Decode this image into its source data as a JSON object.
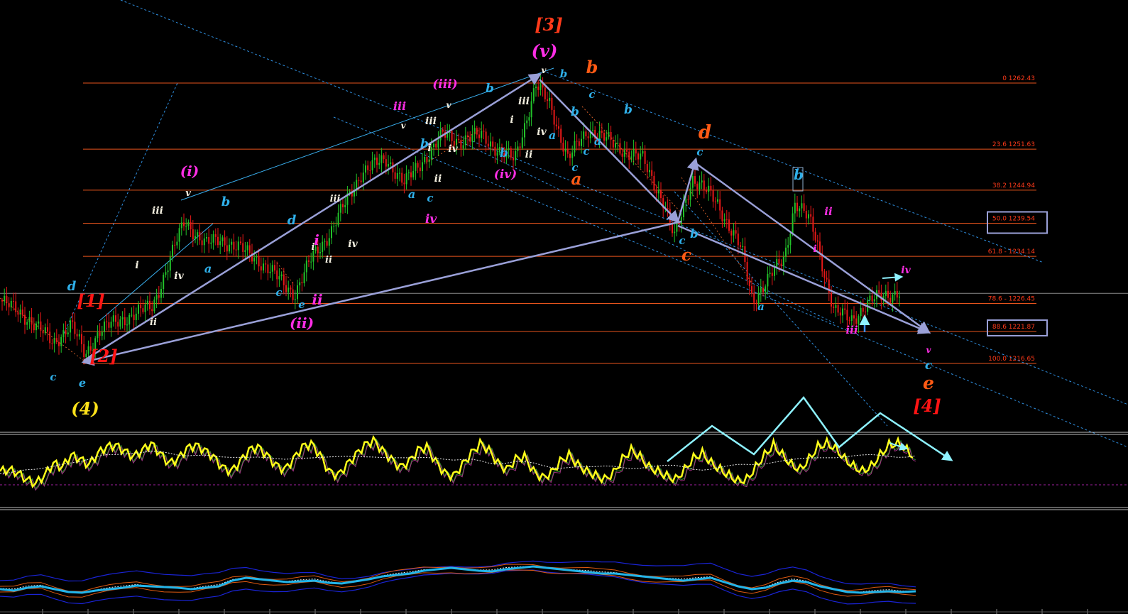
{
  "colors": {
    "background": "#000000",
    "fib_line": "#e8541c",
    "fib_text": "#ff3a1a",
    "trend_arrow": "#9aa0d8",
    "channel_blue": "#2f8fe0",
    "bull_candle": "#22c22a",
    "bear_candle": "#e81818",
    "oscillator": "#ffff1a",
    "signal_cyan": "#8ef2ff",
    "ma_cyan": "#22b5ea",
    "band_blue": "#1a24d6",
    "band_orange": "#e05a10"
  },
  "chart_data": [
    {
      "type": "candlestick",
      "title": "",
      "y_range": [
        1206.0,
        1268.5
      ],
      "fib_levels": [
        {
          "label": "0 1262.43",
          "value": 1262.43
        },
        {
          "label": "23.6 1251.63",
          "value": 1251.63
        },
        {
          "label": "38.2 1244.94",
          "value": 1244.94
        },
        {
          "label": "50.0 1239.54",
          "value": 1239.54,
          "boxed": true
        },
        {
          "label": "61.8 - 1234.14",
          "value": 1234.14
        },
        {
          "label": "78.6 - 1226.45",
          "value": 1226.45
        },
        {
          "label": "88.6 1221.87",
          "value": 1221.87,
          "boxed": true
        },
        {
          "label": "100.0 1216.65",
          "value": 1216.65
        }
      ],
      "current_price": 1228.1,
      "price_path": [
        [
          0,
          1227
        ],
        [
          40,
          1224
        ],
        [
          75,
          1220
        ],
        [
          100,
          1223
        ],
        [
          120,
          1218
        ],
        [
          140,
          1222
        ],
        [
          175,
          1224
        ],
        [
          215,
          1226
        ],
        [
          260,
          1240
        ],
        [
          290,
          1236
        ],
        [
          310,
          1237
        ],
        [
          360,
          1234
        ],
        [
          415,
          1228
        ],
        [
          440,
          1234
        ],
        [
          465,
          1238
        ],
        [
          510,
          1248
        ],
        [
          545,
          1250
        ],
        [
          570,
          1246
        ],
        [
          590,
          1249
        ],
        [
          625,
          1254
        ],
        [
          650,
          1253
        ],
        [
          680,
          1254
        ],
        [
          705,
          1251
        ],
        [
          725,
          1250
        ],
        [
          755,
          1262
        ],
        [
          775,
          1259
        ],
        [
          800,
          1250
        ],
        [
          830,
          1255
        ],
        [
          870,
          1252
        ],
        [
          905,
          1250
        ],
        [
          935,
          1243
        ],
        [
          950,
          1237
        ],
        [
          975,
          1247
        ],
        [
          1010,
          1243
        ],
        [
          1045,
          1235
        ],
        [
          1060,
          1227
        ],
        [
          1080,
          1230
        ],
        [
          1105,
          1234
        ],
        [
          1120,
          1243
        ],
        [
          1140,
          1240
        ],
        [
          1150,
          1237
        ],
        [
          1175,
          1225
        ],
        [
          1200,
          1224
        ],
        [
          1230,
          1227
        ],
        [
          1245,
          1228
        ],
        [
          1270,
          1228.1
        ]
      ],
      "annotations": [
        {
          "text": "[3]",
          "color": "#ff3a1a",
          "size": 24
        },
        {
          "text": "(v)",
          "color": "#ff2ee6",
          "size": 24
        },
        {
          "text": "b",
          "color": "#ff5a14",
          "size": 24
        },
        {
          "text": "v",
          "color": "#f4f0e0",
          "size": 12
        },
        {
          "text": "b",
          "color": "#2fb0ea",
          "size": 15
        },
        {
          "text": "(iii)",
          "color": "#ff2ee6",
          "size": 17
        },
        {
          "text": "b",
          "color": "#2fb0ea",
          "size": 17
        },
        {
          "text": "iii",
          "color": "#ff2ee6",
          "size": 16
        },
        {
          "text": "v",
          "color": "#f4f0e0",
          "size": 12
        },
        {
          "text": "v",
          "color": "#f4f0e0",
          "size": 12
        },
        {
          "text": "iii",
          "color": "#f4f0e0",
          "size": 14
        },
        {
          "text": "iii",
          "color": "#f4f0e0",
          "size": 14
        },
        {
          "text": "i",
          "color": "#f4f0e0",
          "size": 14
        },
        {
          "text": "iv",
          "color": "#f4f0e0",
          "size": 14
        },
        {
          "text": "a",
          "color": "#2fb0ea",
          "size": 16
        },
        {
          "text": "c",
          "color": "#2fb0ea",
          "size": 15
        },
        {
          "text": "b",
          "color": "#2fb0ea",
          "size": 17
        },
        {
          "text": "a",
          "color": "#2fb0ea",
          "size": 16
        },
        {
          "text": "b",
          "color": "#2fb0ea",
          "size": 17
        },
        {
          "text": "c",
          "color": "#2fb0ea",
          "size": 15
        },
        {
          "text": "b",
          "color": "#2fb0ea",
          "size": 17
        },
        {
          "text": "i",
          "color": "#f4f0e0",
          "size": 14
        },
        {
          "text": "iv",
          "color": "#f4f0e0",
          "size": 14
        },
        {
          "text": "a",
          "color": "#2fb0ea",
          "size": 16
        },
        {
          "text": "c",
          "color": "#2fb0ea",
          "size": 15
        },
        {
          "text": "ii",
          "color": "#f4f0e0",
          "size": 14
        },
        {
          "text": "b",
          "color": "#2fb0ea",
          "size": 17
        },
        {
          "text": "c",
          "color": "#2fb0ea",
          "size": 15
        },
        {
          "text": "a",
          "color": "#ff5a14",
          "size": 23
        },
        {
          "text": "(iv)",
          "color": "#ff2ee6",
          "size": 17
        },
        {
          "text": "ii",
          "color": "#f4f0e0",
          "size": 14
        },
        {
          "text": "d",
          "color": "#ff5a14",
          "size": 26
        },
        {
          "text": "c",
          "color": "#2fb0ea",
          "size": 15
        },
        {
          "text": "b",
          "color": "#2fb0ea",
          "size": 20
        },
        {
          "text": "ii",
          "color": "#ff2ee6",
          "size": 15
        },
        {
          "text": "i",
          "color": "#ff2ee6",
          "size": 14
        },
        {
          "text": "c",
          "color": "#2fb0ea",
          "size": 15
        },
        {
          "text": "b",
          "color": "#2fb0ea",
          "size": 17
        },
        {
          "text": "c",
          "color": "#ff5a14",
          "size": 23
        },
        {
          "text": "iv",
          "color": "#ff2ee6",
          "size": 14
        },
        {
          "text": "a",
          "color": "#2fb0ea",
          "size": 15
        },
        {
          "text": "iii",
          "color": "#ff2ee6",
          "size": 15
        },
        {
          "text": "v",
          "color": "#ff2ee6",
          "size": 12
        },
        {
          "text": "c",
          "color": "#2fb0ea",
          "size": 17
        },
        {
          "text": "e",
          "color": "#ff5a14",
          "size": 25
        },
        {
          "text": "[4]",
          "color": "#ff1414",
          "size": 24
        },
        {
          "text": "iv",
          "color": "#ff2ee6",
          "size": 17
        },
        {
          "text": "(i)",
          "color": "#ff2ee6",
          "size": 20
        },
        {
          "text": "v",
          "color": "#f4f0e0",
          "size": 13
        },
        {
          "text": "iii",
          "color": "#f4f0e0",
          "size": 14
        },
        {
          "text": "b",
          "color": "#2fb0ea",
          "size": 18
        },
        {
          "text": "i",
          "color": "#f4f0e0",
          "size": 14
        },
        {
          "text": "iv",
          "color": "#f4f0e0",
          "size": 14
        },
        {
          "text": "a",
          "color": "#2fb0ea",
          "size": 16
        },
        {
          "text": "ii",
          "color": "#f4f0e0",
          "size": 13
        },
        {
          "text": "d",
          "color": "#2fb0ea",
          "size": 18
        },
        {
          "text": "[1]",
          "color": "#ff1414",
          "size": 24
        },
        {
          "text": "[2]",
          "color": "#ff1414",
          "size": 24
        },
        {
          "text": "c",
          "color": "#2fb0ea",
          "size": 15
        },
        {
          "text": "e",
          "color": "#2fb0ea",
          "size": 16
        },
        {
          "text": "(4)",
          "color": "#ffe21a",
          "size": 24
        },
        {
          "text": "d",
          "color": "#2fb0ea",
          "size": 18
        },
        {
          "text": "i",
          "color": "#ff2ee6",
          "size": 20
        },
        {
          "text": "i",
          "color": "#f4f0e0",
          "size": 13
        },
        {
          "text": "iii",
          "color": "#f4f0e0",
          "size": 13
        },
        {
          "text": "iv",
          "color": "#f4f0e0",
          "size": 14
        },
        {
          "text": "ii",
          "color": "#f4f0e0",
          "size": 13
        },
        {
          "text": "c",
          "color": "#2fb0ea",
          "size": 15
        },
        {
          "text": "e",
          "color": "#2fb0ea",
          "size": 15
        },
        {
          "text": "ii",
          "color": "#ff2ee6",
          "size": 20
        },
        {
          "text": "(ii)",
          "color": "#ff2ee6",
          "size": 20
        },
        {
          "text": "iv",
          "color": "#ff2ee6",
          "size": 20
        }
      ]
    },
    {
      "type": "line",
      "title": "",
      "series_color": "#ffff1a",
      "values": [
        40,
        42,
        38,
        30,
        25,
        35,
        50,
        45,
        60,
        55,
        48,
        62,
        70,
        72,
        65,
        58,
        66,
        74,
        62,
        50,
        55,
        68,
        72,
        66,
        58,
        45,
        40,
        52,
        66,
        70,
        60,
        48,
        42,
        55,
        70,
        74,
        60,
        40,
        35,
        48,
        60,
        72,
        78,
        66,
        55,
        45,
        52,
        66,
        70,
        52,
        38,
        34,
        48,
        62,
        74,
        66,
        50,
        42,
        55,
        58,
        40,
        32,
        38,
        52,
        60,
        48,
        40,
        35,
        30,
        38,
        55,
        66,
        58,
        45,
        40,
        34,
        30,
        42,
        56,
        62,
        50,
        42,
        35,
        28,
        30,
        45,
        60,
        72,
        60,
        48,
        42,
        55,
        70,
        74,
        68,
        55,
        46,
        40,
        46,
        60,
        72,
        74,
        66,
        55
      ]
    },
    {
      "type": "line",
      "title": "",
      "series_color": "#22b5ea",
      "values": [
        210,
        208,
        212,
        214,
        210,
        206,
        205,
        208,
        210,
        212,
        215,
        214,
        213,
        212,
        210,
        212,
        214,
        222,
        226,
        224,
        222,
        220,
        221,
        222,
        219,
        218,
        221,
        224,
        228,
        230,
        232,
        236,
        238,
        240,
        238,
        236,
        235,
        238,
        240,
        242,
        240,
        238,
        236,
        234,
        232,
        232,
        230,
        228,
        226,
        224,
        222,
        224,
        226,
        220,
        214,
        210,
        212,
        218,
        222,
        220,
        214,
        210,
        206,
        205,
        206,
        207,
        206,
        207
      ]
    }
  ]
}
